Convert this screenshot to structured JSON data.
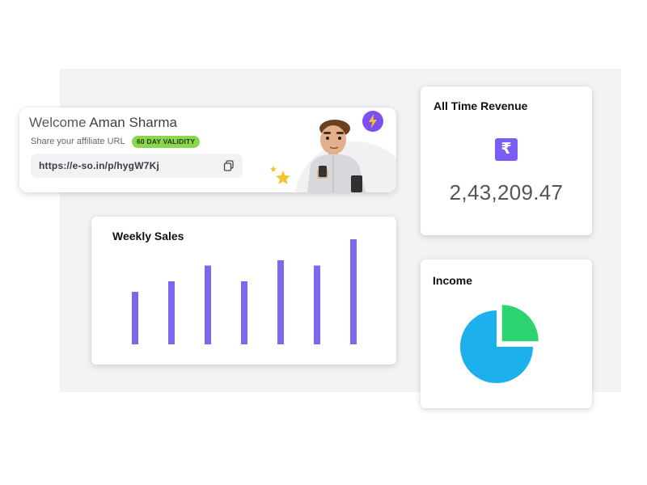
{
  "welcome": {
    "greeting": "Welcome",
    "name": "Aman Sharma",
    "affiliate_label": "Share your affiliate URL",
    "validity_badge": "60 DAY VALIDITY",
    "affiliate_url": "https://e-so.in/p/hygW7Kj",
    "icons": [
      "copy-icon",
      "lightning-icon",
      "star-icon"
    ]
  },
  "revenue": {
    "title": "All Time Revenue",
    "currency_icon": "rupee-icon",
    "value": "2,43,209.47",
    "accent_color": "#7b5cf5"
  },
  "chart_data": [
    {
      "type": "bar",
      "title": "Weekly Sales",
      "categories": [
        "",
        "",
        "",
        "",
        "",
        "",
        ""
      ],
      "values": [
        50,
        60,
        75,
        60,
        80,
        75,
        100
      ],
      "ylim": [
        0,
        100
      ],
      "color": "#7b68ee",
      "grid": false
    },
    {
      "type": "pie",
      "title": "Income",
      "slices": [
        {
          "value": 75,
          "color": "#1cb0ec"
        },
        {
          "value": 25,
          "color": "#2dd36f"
        }
      ]
    }
  ]
}
